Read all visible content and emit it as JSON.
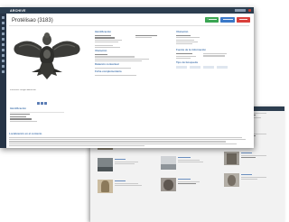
{
  "app": {
    "name": "ARCHIVE"
  },
  "record": {
    "title": "Protélisao (3183)"
  },
  "toolbar": {
    "btn_green": "< ",
    "btn_blue": "",
    "btn_red": ""
  },
  "image": {
    "caption": "Ilustración: Imagen Adoración"
  },
  "left_section": {
    "heading": "Identificación"
  },
  "col1": {
    "heading": "Identificación",
    "heading2": "Ubicación",
    "heading3": "Datación contextual",
    "heading4": "Ficha complementaria"
  },
  "col2": {
    "heading": "Ubicación",
    "heading2": "Fuente de la información",
    "heading3": "Tipo de búsqueda"
  },
  "bottom": {
    "heading": "Localización en el contexto"
  },
  "colors": {
    "green": "#3aa552",
    "blue": "#3b79c8",
    "red": "#d9403c",
    "navy": "#2c3e50"
  }
}
